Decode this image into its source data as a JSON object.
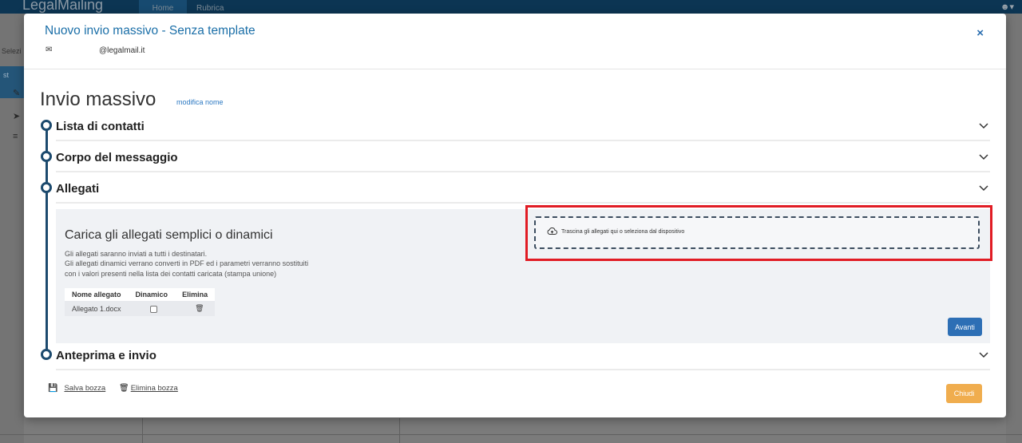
{
  "app": {
    "logo": "LegalMailing",
    "nav": {
      "home": "Home",
      "rubrica": "Rubrica"
    },
    "side_select": "Selezi",
    "side_block_label": "st"
  },
  "modal": {
    "title": "Nuovo invio massivo - Senza template",
    "close": "×",
    "sender": {
      "icon": "envelope-icon",
      "email": "@legalmail.it"
    },
    "page_title": "Invio massivo",
    "edit_name_link": "modifica nome",
    "sections": {
      "contacts": "Lista di contatti",
      "body": "Corpo del messaggio",
      "attachments": "Allegati",
      "preview": "Anteprima e invio"
    },
    "attachments": {
      "heading": "Carica gli allegati semplici o dinamici",
      "desc_line1": "Gli allegati saranno inviati a tutti i destinatari.",
      "desc_line2": "Gli allegati dinamici verrano converti in PDF ed i parametri verranno sostituiti",
      "desc_line3": "con i valori presenti nella lista dei contatti caricata (stampa unione)",
      "table": {
        "headers": [
          "Nome allegato",
          "Dinamico",
          "Elimina"
        ],
        "rows": [
          {
            "name": "Allegato 1.docx",
            "dynamic": false
          }
        ]
      },
      "dropzone_text": "Trascina gli allegati qui o seleziona dal dispositivo",
      "next_button": "Avanti"
    },
    "footer": {
      "save_draft": "Salva bozza",
      "delete_draft": "Elimina bozza",
      "close_button": "Chiudi"
    }
  },
  "colors": {
    "accent": "#2d6fb5",
    "title": "#1b6fa8",
    "timeline": "#1c4a6e",
    "highlight": "#e11c24",
    "warning_button": "#f0ad4e"
  }
}
